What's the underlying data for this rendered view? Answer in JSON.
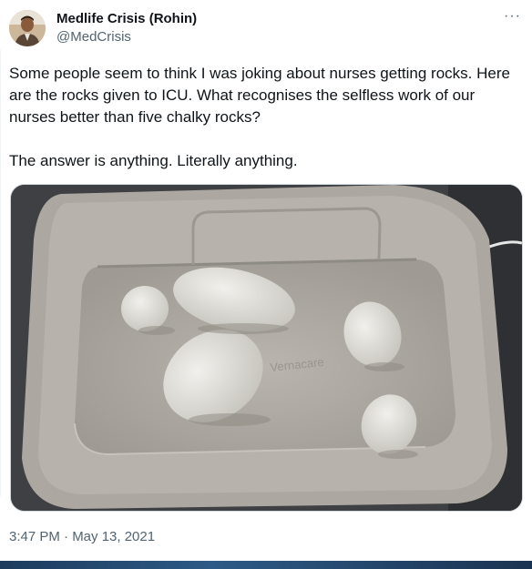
{
  "author": {
    "display_name": "Medlife Crisis (Rohin)",
    "handle": "@MedCrisis",
    "avatar_icon": "profile-photo"
  },
  "menu_icon": "more-horizontal-icon",
  "tweet": {
    "text": "Some people seem to think I was joking about nurses getting rocks. Here are the rocks given to ICU. What recognises the selfless work of our nurses better than five chalky rocks?\n\nThe answer is anything. Literally anything.",
    "timestamp": "3:47 PM · May 13, 2021"
  },
  "media": {
    "icon": "photo-rocks-in-cardboard-tray",
    "tray_print": "Vernacare"
  },
  "colors": {
    "text_primary": "#0f1419",
    "text_secondary": "#536471",
    "border": "#cfd9de"
  }
}
